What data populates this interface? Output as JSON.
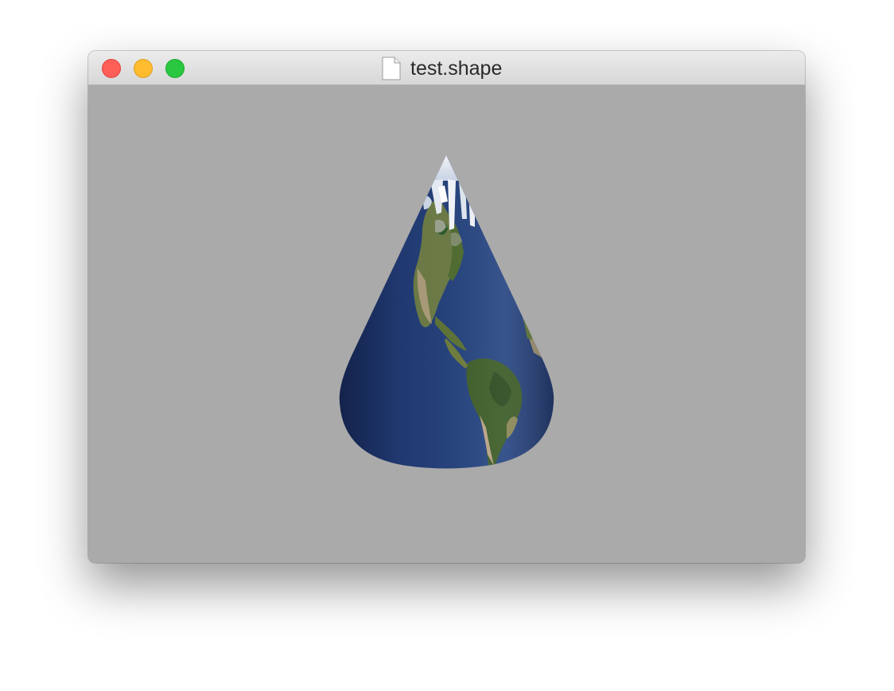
{
  "window": {
    "title": "test.shape",
    "document_icon": "document-icon",
    "controls": {
      "close": {
        "icon": "close-button",
        "color": "#fd5f57"
      },
      "minimize": {
        "icon": "minimize-button",
        "color": "#febc2e"
      },
      "maximize": {
        "icon": "maximize-button",
        "color": "#2ac840"
      }
    }
  },
  "viewport": {
    "background": "#aaaaaa",
    "object": "cone",
    "texture": "earth-map",
    "ocean_color": "#213b73",
    "land_color": "#556b3a"
  }
}
